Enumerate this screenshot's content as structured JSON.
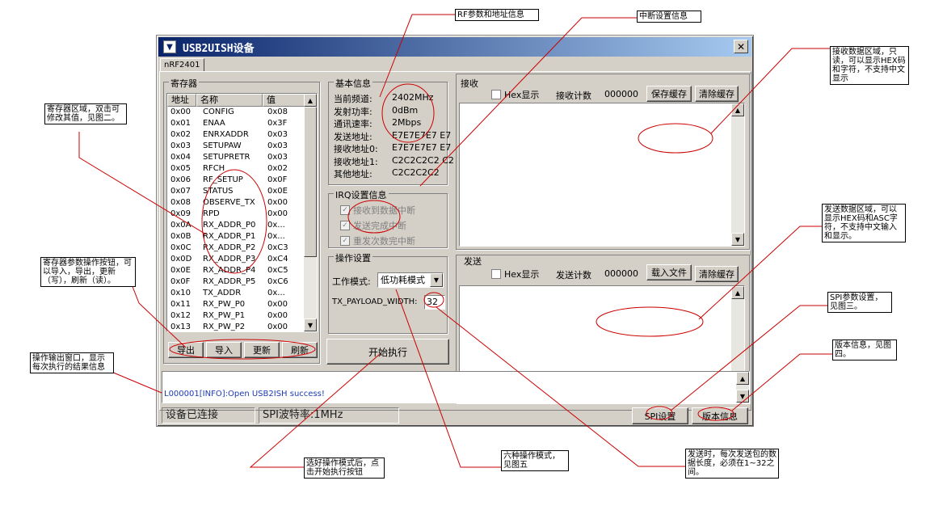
{
  "window": {
    "title": "USB2UISH设备",
    "close_glyph": "✕",
    "tab": "nRF2401"
  },
  "registers": {
    "group_title": "寄存器",
    "headers": [
      "地址",
      "名称",
      "值"
    ],
    "rows": [
      [
        "0x00",
        "CONFIG",
        "0x08"
      ],
      [
        "0x01",
        "ENAA",
        "0x3F"
      ],
      [
        "0x02",
        "ENRXADDR",
        "0x03"
      ],
      [
        "0x03",
        "SETUPAW",
        "0x03"
      ],
      [
        "0x04",
        "SETUPRETR",
        "0x03"
      ],
      [
        "0x05",
        "RFCH",
        "0x02"
      ],
      [
        "0x06",
        "RF_SETUP",
        "0x0F"
      ],
      [
        "0x07",
        "STATUS",
        "0x0E"
      ],
      [
        "0x08",
        "OBSERVE_TX",
        "0x00"
      ],
      [
        "0x09",
        "RPD",
        "0x00"
      ],
      [
        "0x0A",
        "RX_ADDR_P0",
        "0x..."
      ],
      [
        "0x0B",
        "RX_ADDR_P1",
        "0x..."
      ],
      [
        "0x0C",
        "RX_ADDR_P2",
        "0xC3"
      ],
      [
        "0x0D",
        "RX_ADDR_P3",
        "0xC4"
      ],
      [
        "0x0E",
        "RX_ADDR_P4",
        "0xC5"
      ],
      [
        "0x0F",
        "RX_ADDR_P5",
        "0xC6"
      ],
      [
        "0x10",
        "TX_ADDR",
        "0x..."
      ],
      [
        "0x11",
        "RX_PW_P0",
        "0x00"
      ],
      [
        "0x12",
        "RX_PW_P1",
        "0x00"
      ],
      [
        "0x13",
        "RX_PW_P2",
        "0x00"
      ]
    ],
    "buttons": [
      "导出",
      "导入",
      "更新",
      "刷新"
    ]
  },
  "basic_info": {
    "group_title": "基本信息",
    "rows": [
      {
        "label": "当前频道:",
        "value": "2402MHz"
      },
      {
        "label": "发射功率:",
        "value": "0dBm"
      },
      {
        "label": "通讯速率:",
        "value": "2Mbps"
      },
      {
        "label": "发送地址:",
        "value": "E7E7E7E7 E7"
      },
      {
        "label": "接收地址0:",
        "value": "E7E7E7E7 E7"
      },
      {
        "label": "接收地址1:",
        "value": "C2C2C2C2 C2"
      },
      {
        "label": "其他地址:",
        "value": "C2C2C2C2"
      }
    ]
  },
  "irq": {
    "group_title": "IRQ设置信息",
    "items": [
      "接收到数据中断",
      "发送完成中断",
      "重发次数完中断"
    ]
  },
  "operation": {
    "group_title": "操作设置",
    "mode_label": "工作模式:",
    "mode_value": "低功耗模式",
    "payload_label": "TX_PAYLOAD_WIDTH:",
    "payload_value": "32",
    "start_button": "开始执行"
  },
  "receive": {
    "title": "接收",
    "hex_label": "Hex显示",
    "count_label": "接收计数",
    "count_value": "000000",
    "save_button": "保存缓存",
    "clear_button": "清除缓存"
  },
  "send": {
    "title": "发送",
    "hex_label": "Hex显示",
    "count_label": "发送计数",
    "count_value": "000000",
    "load_button": "载入文件",
    "clear_button": "清除缓存"
  },
  "log": {
    "line": "L000001[INFO]:Open USB2ISH success!"
  },
  "statusbar": {
    "connection": "设备已连接",
    "spi_rate": "SPI波特率:1MHz",
    "spi_button": "SPI设置",
    "version_button": "版本信息"
  },
  "annotations": {
    "rf": "RF参数和地址信息",
    "irq": "中断设置信息",
    "register_area": "寄存器区域，双击可修改其值，见图二。",
    "register_ops": "寄存器参数操作按钮，可以导入，导出，更新（写），刷新（读）。",
    "output": "操作输出窗口，显示每次执行的结果信息",
    "start": "选好操作模式后，点击开始执行按钮",
    "modes": "六种操作模式，见图五",
    "payload": "发送时，每次发送包的数据长度，必须在1~32之间。",
    "receive": "接收数据区域，只读，可以显示HEX码和字符，不支持中文显示",
    "send": "发送数据区域，可以显示HEX码和ASC字符，不支持中文输入和显示。",
    "spi": "SPI参数设置，见图三。",
    "version": "版本信息，见图四。"
  }
}
